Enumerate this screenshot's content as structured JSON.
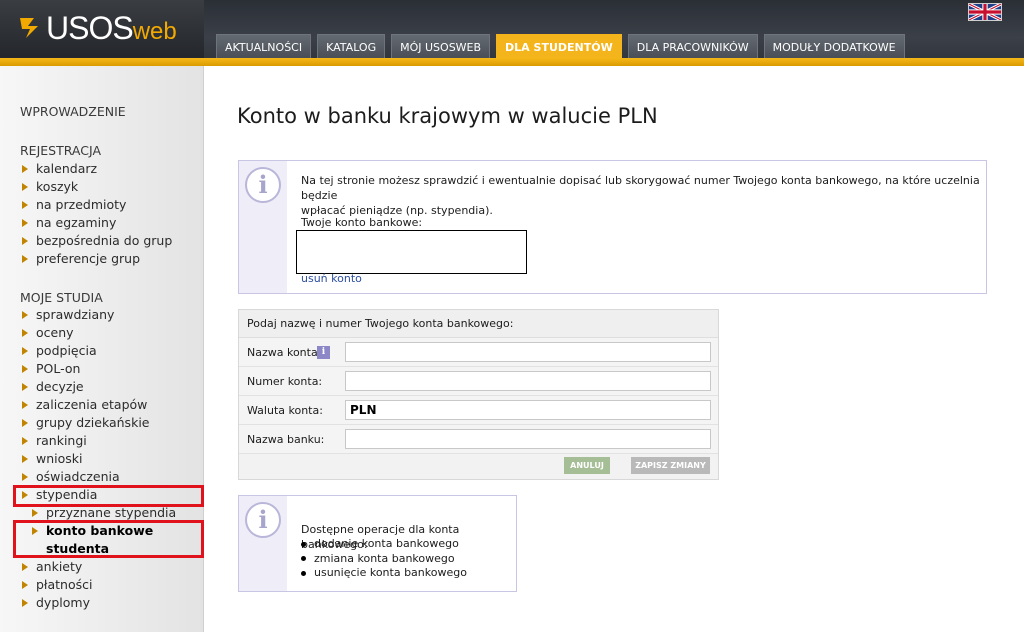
{
  "header": {
    "logo_text": "USOS",
    "logo_suffix": "web",
    "tabs": [
      {
        "label": "AKTUALNOŚCI"
      },
      {
        "label": "KATALOG"
      },
      {
        "label": "MÓJ USOSWEB"
      },
      {
        "label": "DLA STUDENTÓW",
        "active": true
      },
      {
        "label": "DLA PRACOWNIKÓW"
      },
      {
        "label": "MODUŁY DODATKOWE"
      }
    ],
    "language_flag": "uk-flag-icon"
  },
  "sidebar": {
    "intro": "WPROWADZENIE",
    "registration": {
      "title": "REJESTRACJA",
      "items": [
        "kalendarz",
        "koszyk",
        "na przedmioty",
        "na egzaminy",
        "bezpośrednia do grup",
        "preferencje grup"
      ]
    },
    "studies": {
      "title": "MOJE STUDIA",
      "items": [
        "sprawdziany",
        "oceny",
        "podpięcia",
        "POL-on",
        "decyzje",
        "zaliczenia etapów",
        "grupy dziekańskie",
        "rankingi",
        "wnioski",
        "oświadczenia",
        "stypendia"
      ],
      "sub_items": [
        "przyznane stypendia",
        "konto bankowe",
        "studenta"
      ],
      "after_items": [
        "ankiety",
        "płatności",
        "dyplomy"
      ]
    },
    "highlight_color": "#e0121c"
  },
  "main": {
    "title": "Konto w banku krajowym w walucie PLN",
    "info": {
      "text_line1": "Na tej stronie możesz sprawdzić i ewentualnie dopisać lub skorygować numer Twojego konta bankowego, na które uczelnia będzie",
      "text_line2": "wpłacać pieniądze (np. stypendia).",
      "account_label": "Twoje konto bankowe:",
      "account_value": "",
      "remove_link": "usuń konto"
    },
    "form": {
      "heading": "Podaj nazwę i numer Twojego konta bankowego:",
      "fields": [
        {
          "label": "Nazwa konta:",
          "value": ""
        },
        {
          "label": "Numer konta:",
          "value": ""
        },
        {
          "label": "Waluta konta:",
          "value": "PLN"
        },
        {
          "label": "Nazwa banku:",
          "value": ""
        }
      ],
      "cancel_label": "ANULUJ",
      "save_label": "ZAPISZ ZMIANY"
    },
    "ops": {
      "title": "Dostępne operacje dla konta bankowego:",
      "items": [
        "dodanie konta bankowego",
        "zmiana konta bankowego",
        "usunięcie konta bankowego"
      ]
    }
  },
  "colors": {
    "accent": "#f4b41c",
    "header_dark": "#30353c",
    "info_border": "#c9c5e4"
  }
}
